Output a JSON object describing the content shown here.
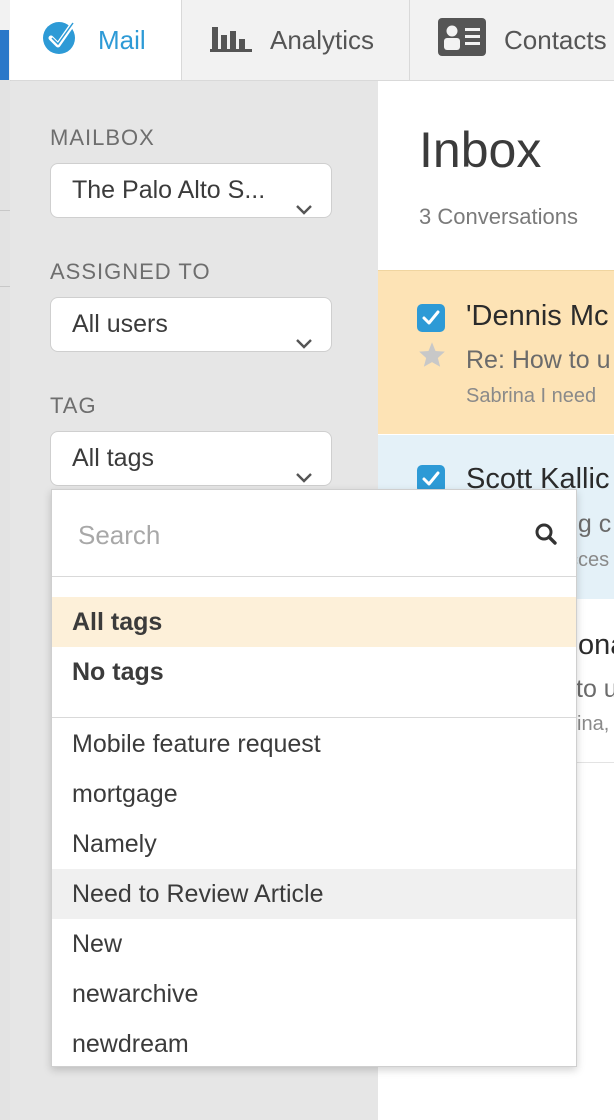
{
  "tabs": [
    {
      "label": "Mail",
      "icon": "checkmark-badge-icon",
      "active": true
    },
    {
      "label": "Analytics",
      "icon": "bar-chart-icon",
      "active": false
    },
    {
      "label": "Contacts",
      "icon": "contact-card-icon",
      "active": false
    }
  ],
  "sidebar": {
    "mailbox": {
      "label": "MAILBOX",
      "value": "The Palo Alto S..."
    },
    "assigned": {
      "label": "ASSIGNED TO",
      "value": "All users"
    },
    "tag": {
      "label": "TAG",
      "value": "All tags"
    }
  },
  "main": {
    "title": "Inbox",
    "count": "3 Conversations",
    "conversations": [
      {
        "name": "'Dennis Mc",
        "subject": "Re: How to u",
        "preview": "Sabrina I need"
      },
      {
        "name": "Scott Kallic",
        "subject": "ng c",
        "preview": "cces"
      },
      {
        "name": "ona",
        "subject": "to u",
        "preview": "ina,"
      }
    ]
  },
  "tag_dropdown": {
    "search_placeholder": "Search",
    "special": [
      "All tags",
      "No tags"
    ],
    "tags": [
      "Mobile feature request",
      "mortgage",
      "Namely",
      "Need to Review Article",
      "New",
      "newarchive",
      "newdream"
    ]
  },
  "colors": {
    "accent": "#2d9ad6",
    "selected_row": "#fde3b5",
    "second_row": "#e4f1f8",
    "dropdown_selected": "#fdf0d9"
  }
}
